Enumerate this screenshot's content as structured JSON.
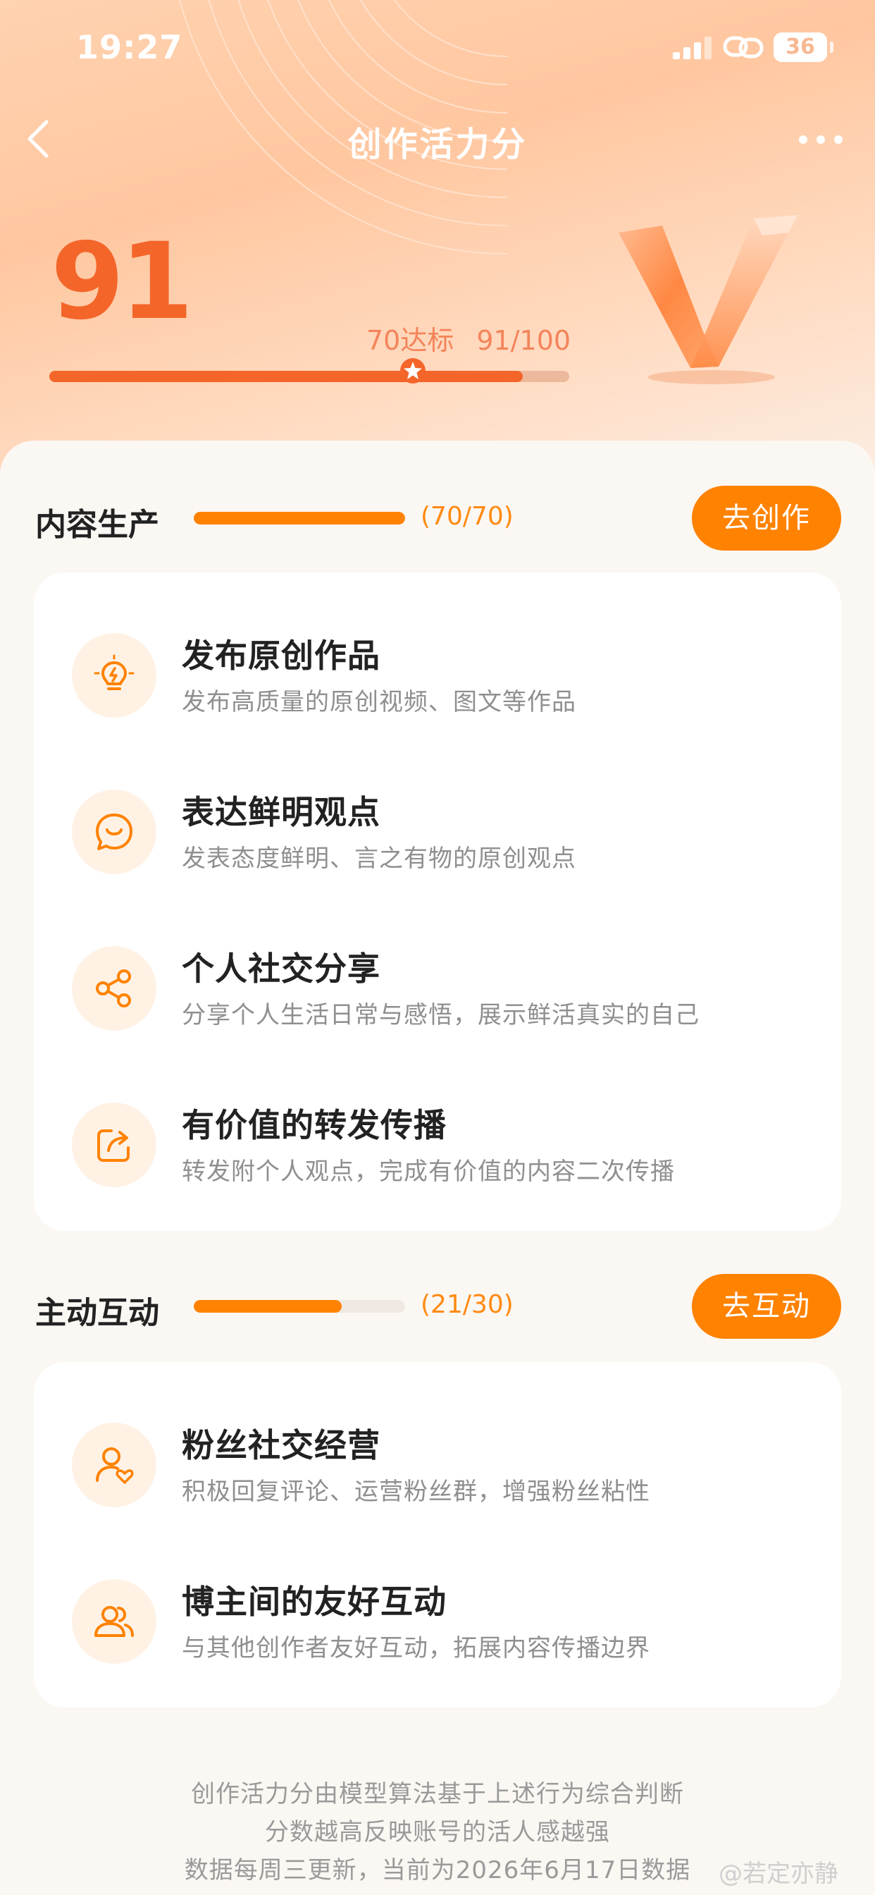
{
  "status_bar": {
    "time": "19:27",
    "battery": "36"
  },
  "nav": {
    "title": "创作活力分"
  },
  "score": {
    "value": "91",
    "target_label": "70达标",
    "ratio_label": "91/100",
    "progress": 0.91,
    "target_marker": 0.7
  },
  "sections": [
    {
      "title": "内容生产",
      "count": "(70/70)",
      "progress": 1.0,
      "button": "去创作",
      "items": [
        {
          "icon": "lightbulb-icon",
          "title": "发布原创作品",
          "desc": "发布高质量的原创视频、图文等作品"
        },
        {
          "icon": "chat-smile-icon",
          "title": "表达鲜明观点",
          "desc": "发表态度鲜明、言之有物的原创观点"
        },
        {
          "icon": "share-icon",
          "title": "个人社交分享",
          "desc": "分享个人生活日常与感悟，展示鲜活真实的自己"
        },
        {
          "icon": "repost-icon",
          "title": "有价值的转发传播",
          "desc": "转发附个人观点，完成有价值的内容二次传播"
        }
      ]
    },
    {
      "title": "主动互动",
      "count": "(21/30)",
      "progress": 0.7,
      "button": "去互动",
      "items": [
        {
          "icon": "user-heart-icon",
          "title": "粉丝社交经营",
          "desc": "积极回复评论、运营粉丝群，增强粉丝粘性"
        },
        {
          "icon": "users-icon",
          "title": "博主间的友好互动",
          "desc": "与其他创作者友好互动，拓展内容传播边界"
        }
      ]
    }
  ],
  "footer": {
    "line1": "创作活力分由模型算法基于上述行为综合判断",
    "line2": "分数越高反映账号的活人感越强",
    "line3": "数据每周三更新，当前为2026年6月17日数据"
  },
  "watermark": "@若定亦静",
  "colors": {
    "accent": "#ff8200",
    "score": "#f4652a",
    "icon_bg": "#fff2e5"
  }
}
